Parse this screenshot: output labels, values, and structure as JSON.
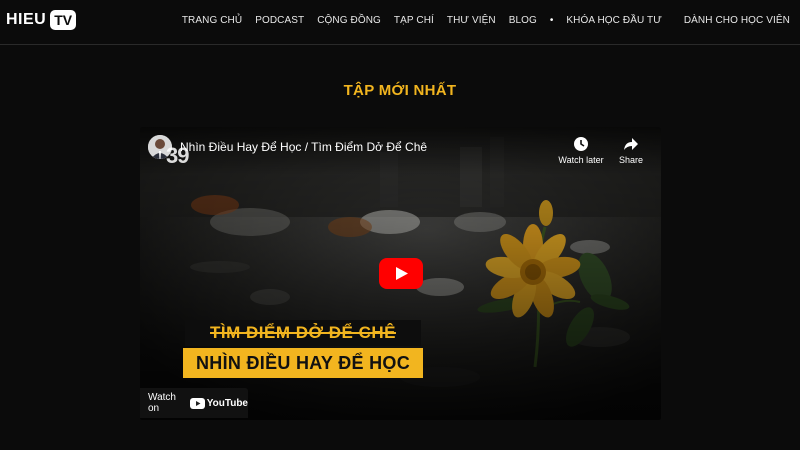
{
  "header": {
    "logo_text": "HIEU",
    "logo_box": "TV",
    "nav": [
      "TRANG CHỦ",
      "PODCAST",
      "CỘNG ĐỒNG",
      "TẠP CHÍ",
      "THƯ VIỆN",
      "BLOG",
      "KHÓA HỌC ĐẦU TƯ",
      "DÀNH CHO HỌC VIÊN"
    ],
    "nav_separator": "•"
  },
  "section": {
    "title": "TẬP MỚI NHẤT"
  },
  "video": {
    "episode_number": "39",
    "title": "Nhìn Điều Hay Để Học / Tìm Điểm Dở Để Chê",
    "watch_later": "Watch later",
    "share": "Share",
    "caption_strike": "TÌM ĐIỂM DỞ ĐỂ CHÊ",
    "caption_main": "NHÌN ĐIỀU HAY ĐỂ HỌC",
    "watch_on": "Watch on",
    "youtube": "YouTube"
  },
  "colors": {
    "accent": "#f2b51f",
    "background": "#0b0b0b",
    "youtube_red": "#ff0000"
  }
}
